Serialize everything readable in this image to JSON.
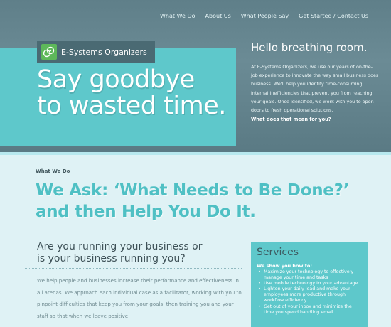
{
  "nav": {
    "items": [
      "What We Do",
      "About Us",
      "What People Say",
      "Get Started / Contact Us"
    ]
  },
  "logo": {
    "name": "E-Systems Organizers",
    "icon": "eso-logo-icon"
  },
  "hero": {
    "headline_line1": "Say goodbye",
    "headline_line2": "to wasted time.",
    "hello_title": "Hello breathing room.",
    "hello_text": "At E-Systems Organizers, we use our years of on-the-job experience to innovate the way small business does business. We'll help you identify time-consuming internal inefficiencies that prevent you from reaching your goals. Once identified, we work with you to open doors to fresh operational solutions.",
    "hello_link": "What does that mean for you?"
  },
  "section": {
    "label": "What We Do",
    "heading_line1": "We Ask: ‘What Needs to Be Done?’",
    "heading_line2": "and then Help You Do It."
  },
  "question": {
    "line1": "Are you running your business or",
    "line2": "is your business running you?"
  },
  "body_copy": "We help people and businesses increase their performance and effectiveness in all arenas. We approach each individual case as a facilitator, working with you to pinpoint difficulties that keep you from your goals, then training you and your staff so that when we leave positive",
  "services": {
    "title": "Services",
    "intro": "We show you how to:",
    "items": [
      "Maximize your technology to effectively manage your time and tasks",
      "Use mobile technology to your advantage",
      "Lighten your daily load and make your employees more productive through workflow efficiency",
      "Get out of your inbox and minimize the time you spend handling email"
    ]
  },
  "colors": {
    "teal": "#5ec8cb",
    "slate": "#6b8b95",
    "background": "#dff2f5"
  }
}
